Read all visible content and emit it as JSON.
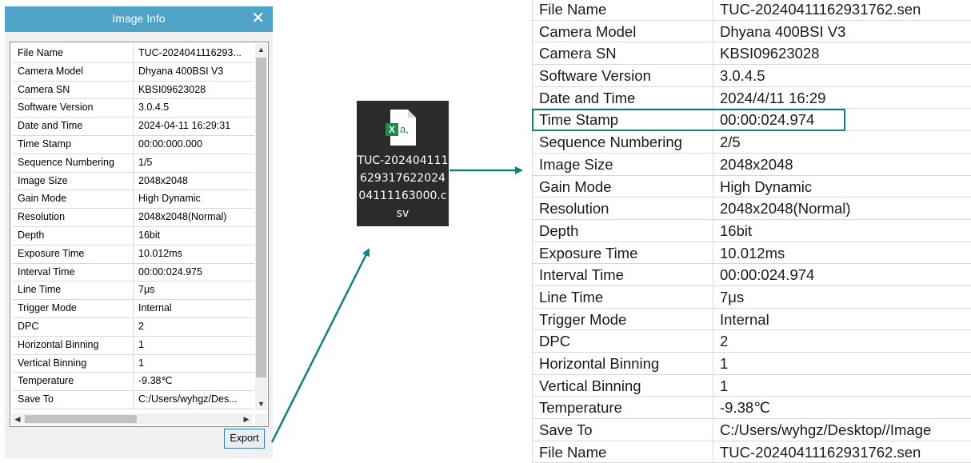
{
  "dialog": {
    "title": "Image Info",
    "close_glyph": "✕",
    "export_label": "Export",
    "rows": [
      {
        "key": "File Name",
        "value": "TUC-2024041116293..."
      },
      {
        "key": "Camera Model",
        "value": "Dhyana 400BSI V3"
      },
      {
        "key": "Camera SN",
        "value": "KBSI09623028"
      },
      {
        "key": "Software Version",
        "value": "3.0.4.5"
      },
      {
        "key": "Date and Time",
        "value": "2024-04-11 16:29:31"
      },
      {
        "key": "Time Stamp",
        "value": "00:00:000.000"
      },
      {
        "key": "Sequence Numbering",
        "value": "1/5"
      },
      {
        "key": "Image Size",
        "value": "2048x2048"
      },
      {
        "key": "Gain Mode",
        "value": "High Dynamic"
      },
      {
        "key": "Resolution",
        "value": "2048x2048(Normal)"
      },
      {
        "key": "Depth",
        "value": "16bit"
      },
      {
        "key": "Exposure Time",
        "value": "10.012ms"
      },
      {
        "key": "Interval Time",
        "value": "00:00:024.975"
      },
      {
        "key": "Line Time",
        "value": "7μs"
      },
      {
        "key": "Trigger Mode",
        "value": "Internal"
      },
      {
        "key": "DPC",
        "value": "2"
      },
      {
        "key": "Horizontal Binning",
        "value": "1"
      },
      {
        "key": "Vertical Binning",
        "value": "1"
      },
      {
        "key": "Temperature",
        "value": "-9.38℃"
      },
      {
        "key": "Save To",
        "value": "C:/Users/wyhgz/Des..."
      }
    ]
  },
  "csv_file": {
    "name": "TUC-20240411162931762202404111163000.csv",
    "icon": "excel-csv-icon",
    "badge_letter": "X",
    "badge_suffix": "a,"
  },
  "csv_table": {
    "rows": [
      {
        "key": "File Name",
        "value": "TUC-20240411162931762.sen"
      },
      {
        "key": "Camera Model",
        "value": "Dhyana 400BSI V3"
      },
      {
        "key": "Camera SN",
        "value": "KBSI09623028"
      },
      {
        "key": "Software Version",
        "value": "3.0.4.5"
      },
      {
        "key": "Date and Time",
        "value": "2024/4/11 16:29"
      },
      {
        "key": "Time Stamp",
        "value": "00:00:024.974"
      },
      {
        "key": "Sequence Numbering",
        "value": "2/5"
      },
      {
        "key": "Image Size",
        "value": "2048x2048"
      },
      {
        "key": "Gain Mode",
        "value": "High Dynamic"
      },
      {
        "key": "Resolution",
        "value": "2048x2048(Normal)"
      },
      {
        "key": "Depth",
        "value": "16bit"
      },
      {
        "key": "Exposure Time",
        "value": "10.012ms"
      },
      {
        "key": "Interval Time",
        "value": "00:00:024.974"
      },
      {
        "key": "Line Time",
        "value": "7μs"
      },
      {
        "key": "Trigger Mode",
        "value": "Internal"
      },
      {
        "key": "DPC",
        "value": "2"
      },
      {
        "key": "Horizontal Binning",
        "value": "1"
      },
      {
        "key": "Vertical Binning",
        "value": "1"
      },
      {
        "key": "Temperature",
        "value": "-9.38℃"
      },
      {
        "key": "Save To",
        "value": "C:/Users/wyhgz/Desktop//Image"
      },
      {
        "key": "File Name",
        "value": "TUC-20240411162931762.sen"
      }
    ],
    "highlighted_row": "Time Stamp"
  },
  "colors": {
    "titlebar": "#4ea3c6",
    "arrow": "#157f7c",
    "highlight": "#157f7c",
    "file_tile": "#2b2b2b",
    "excel_green": "#1d8a4a"
  }
}
